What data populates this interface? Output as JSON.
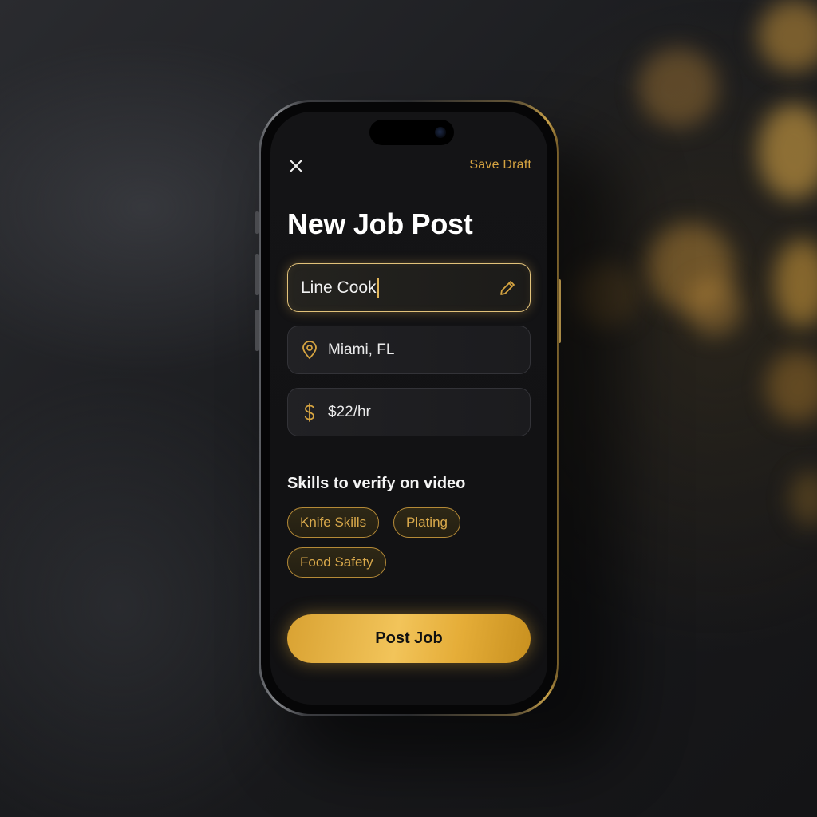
{
  "header": {
    "save_label": "Save Draft",
    "close_icon": "close-icon"
  },
  "page": {
    "title": "New Job Post"
  },
  "form": {
    "job_title": {
      "value": "Line Cook",
      "icon": "pencil-icon"
    },
    "location": {
      "value": "Miami, FL",
      "icon": "map-pin-icon"
    },
    "pay": {
      "value": "$22/hr",
      "icon": "dollar-icon"
    }
  },
  "skills": {
    "title": "Skills to verify on video",
    "items": [
      "Knife Skills",
      "Plating",
      "Food Safety"
    ]
  },
  "actions": {
    "post_label": "Post Job"
  },
  "colors": {
    "accent": "#d6a441",
    "background": "#121214",
    "button_gradient_start": "#d9a232",
    "button_gradient_end": "#c8901f"
  }
}
